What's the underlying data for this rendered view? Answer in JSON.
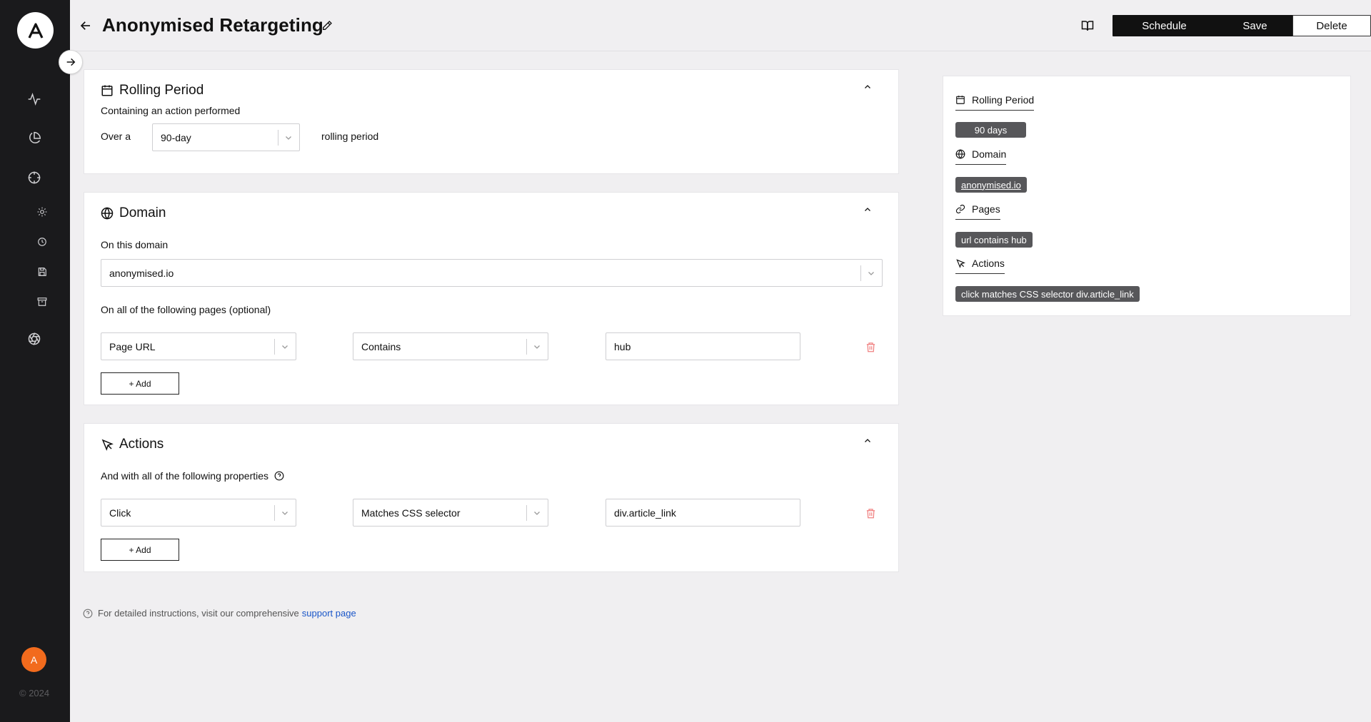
{
  "app": {
    "logo_letter": "A",
    "user_initial": "A",
    "copyright": "© 2024",
    "nav_icons": [
      "activity-icon",
      "pie-chart-icon",
      "target-icon",
      "sun-icon",
      "clock-icon",
      "save-icon",
      "archive-icon",
      "aperture-icon"
    ]
  },
  "header": {
    "title": "Anonymised Retargeting",
    "schedule_label": "Schedule",
    "save_label": "Save",
    "delete_label": "Delete"
  },
  "rolling_period": {
    "title": "Rolling Period",
    "subtitle": "Containing an action performed",
    "over_label": "Over a",
    "period_value": "90-day",
    "suffix": "rolling period"
  },
  "domain": {
    "title": "Domain",
    "domain_label": "On this domain",
    "domain_value": "anonymised.io",
    "pages_label": "On all of the following pages (optional)",
    "rule": {
      "field": "Page URL",
      "operator": "Contains",
      "value": "hub"
    },
    "add_label": "+ Add"
  },
  "actions": {
    "title": "Actions",
    "properties_label": "And with all of the following properties",
    "rule": {
      "field": "Click",
      "operator": "Matches CSS selector",
      "value": "div.article_link"
    },
    "add_label": "+ Add"
  },
  "summary": {
    "rolling_period_title": "Rolling Period",
    "rolling_period_tag": "90 days",
    "domain_title": "Domain",
    "domain_tag": "anonymised.io",
    "pages_title": "Pages",
    "pages_tag": "url contains hub",
    "actions_title": "Actions",
    "actions_tag": "click matches CSS selector div.article_link"
  },
  "footer": {
    "note": "For detailed instructions, visit our comprehensive",
    "link_text": "support page"
  },
  "colors": {
    "sidebar_bg": "#1a1a1c",
    "avatar": "#f26b1d",
    "delete_icon": "#f08080",
    "link": "#1a56c8",
    "tag_bg": "#57575a"
  }
}
